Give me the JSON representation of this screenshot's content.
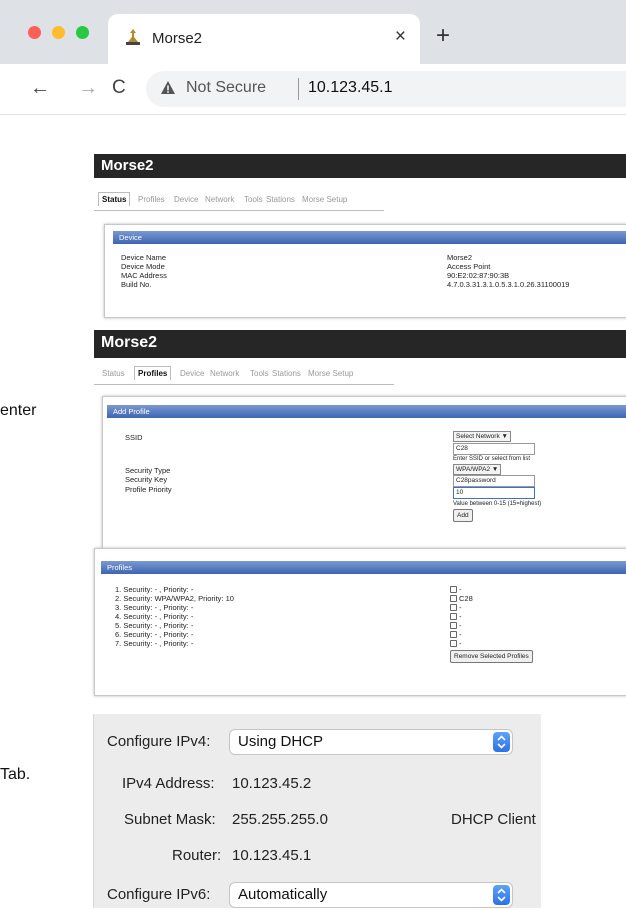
{
  "browser": {
    "tab_title": "Morse2",
    "tab_close": "×",
    "new_tab": "+",
    "back": "←",
    "forward": "→",
    "reload": "C",
    "security_label": "Not Secure",
    "url": "10.123.45.1"
  },
  "side_fragments": {
    "enter": "enter",
    "tab": "Tab."
  },
  "status_page": {
    "brand": "Morse2",
    "nav": [
      "Status",
      "Profiles",
      "Device",
      "Network",
      "Tools",
      "Stations",
      "Morse Setup"
    ],
    "active_tab": "Status",
    "section_title": "Device",
    "rows": [
      {
        "label": "Device Name",
        "value": "Morse2"
      },
      {
        "label": "Device Mode",
        "value": "Access Point"
      },
      {
        "label": "MAC Address",
        "value": "90:E2:02:87:90:3B"
      },
      {
        "label": "Build No.",
        "value": "4.7.0.3.31.3.1.0.5.3.1.0.26.31100019"
      }
    ]
  },
  "profiles_page": {
    "brand": "Morse2",
    "nav": [
      "Status",
      "Profiles",
      "Device",
      "Network",
      "Tools",
      "Stations",
      "Morse Setup"
    ],
    "active_tab": "Profiles",
    "add_profile": {
      "title": "Add Profile",
      "ssid_label": "SSID",
      "select_network": "Select Network",
      "ssid_value": "C28",
      "ssid_hint": "Enter SSID or select from list",
      "security_type_label": "Security Type",
      "security_type_value": "WPA/WPA2",
      "security_key_label": "Security Key",
      "security_key_value": "C28password",
      "priority_label": "Profile Priority",
      "priority_value": "10",
      "priority_hint": "Value between 0-15 (15=highest)",
      "add_button": "Add"
    },
    "profiles": {
      "title": "Profiles",
      "items": [
        {
          "text": "1. Security: - , Priority: -",
          "ssid": "-"
        },
        {
          "text": "2. Security: WPA/WPA2, Priority: 10",
          "ssid": "C28"
        },
        {
          "text": "3. Security: - , Priority: -",
          "ssid": "-"
        },
        {
          "text": "4. Security: - , Priority: -",
          "ssid": "-"
        },
        {
          "text": "5. Security: - , Priority: -",
          "ssid": "-"
        },
        {
          "text": "6. Security: - , Priority: -",
          "ssid": "-"
        },
        {
          "text": "7. Security: - , Priority: -",
          "ssid": "-"
        }
      ],
      "remove_button": "Remove Selected Profiles"
    }
  },
  "network_config": {
    "configure_ipv4_label": "Configure IPv4:",
    "configure_ipv4_value": "Using DHCP",
    "ipv4_address_label": "IPv4 Address:",
    "ipv4_address_value": "10.123.45.2",
    "subnet_mask_label": "Subnet Mask:",
    "subnet_mask_value": "255.255.255.0",
    "dhcp_client_label": "DHCP Client",
    "router_label": "Router:",
    "router_value": "10.123.45.1",
    "configure_ipv6_label": "Configure IPv6:",
    "configure_ipv6_value": "Automatically"
  },
  "colors": {
    "tabbar": "#dee1e6",
    "traffic_red": "#fe5f57",
    "traffic_yellow": "#febc2e",
    "traffic_green": "#28c840",
    "header_dark": "#262626",
    "section_blue": "#3d65b3",
    "mac_accent": "#2c72e8"
  }
}
